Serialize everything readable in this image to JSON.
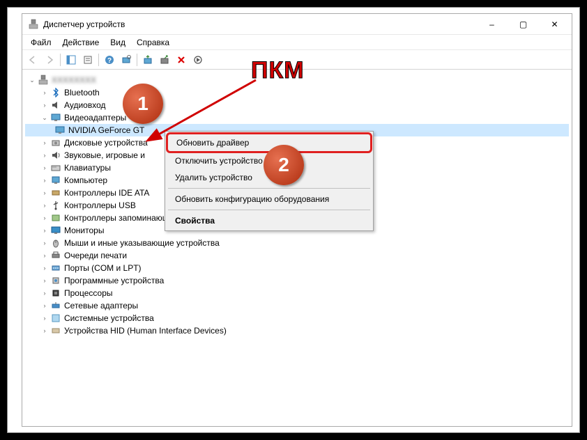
{
  "window": {
    "title": "Диспетчер устройств",
    "controls": {
      "min": "–",
      "max": "▢",
      "close": "✕"
    }
  },
  "menubar": [
    "Файл",
    "Действие",
    "Вид",
    "Справка"
  ],
  "tree": {
    "root": "",
    "items": [
      {
        "label": "Bluetooth",
        "icon": "bluetooth"
      },
      {
        "label": "Аудиовходы и аудиовыходы",
        "icon": "audio",
        "truncated": "Аудиовход"
      },
      {
        "label": "Видеоадаптеры",
        "icon": "display",
        "expanded": true,
        "children": [
          {
            "label": "NVIDIA GeForce GT",
            "icon": "display",
            "selected": true
          }
        ]
      },
      {
        "label": "Дисковые устройства",
        "icon": "disk"
      },
      {
        "label": "Звуковые, игровые и видеоустройства",
        "icon": "sound",
        "truncated": "Звуковые, игровые и"
      },
      {
        "label": "Клавиатуры",
        "icon": "keyboard"
      },
      {
        "label": "Компьютер",
        "icon": "computer"
      },
      {
        "label": "Контроллеры IDE ATA/ATAPI",
        "icon": "ide",
        "truncated": "Контроллеры IDE ATA"
      },
      {
        "label": "Контроллеры USB",
        "icon": "usb"
      },
      {
        "label": "Контроллеры запоминающих устройств",
        "icon": "storage"
      },
      {
        "label": "Мониторы",
        "icon": "monitor"
      },
      {
        "label": "Мыши и иные указывающие устройства",
        "icon": "mouse"
      },
      {
        "label": "Очереди печати",
        "icon": "printer"
      },
      {
        "label": "Порты (COM и LPT)",
        "icon": "port"
      },
      {
        "label": "Программные устройства",
        "icon": "software"
      },
      {
        "label": "Процессоры",
        "icon": "cpu"
      },
      {
        "label": "Сетевые адаптеры",
        "icon": "network"
      },
      {
        "label": "Системные устройства",
        "icon": "system"
      },
      {
        "label": "Устройства HID (Human Interface Devices)",
        "icon": "hid"
      }
    ]
  },
  "context_menu": {
    "items": [
      "Обновить драйвер",
      "Отключить устройство",
      "Удалить устройство",
      "Обновить конфигурацию оборудования",
      "Свойства"
    ]
  },
  "annotations": {
    "label": "ПКМ",
    "badge1": "1",
    "badge2": "2"
  }
}
